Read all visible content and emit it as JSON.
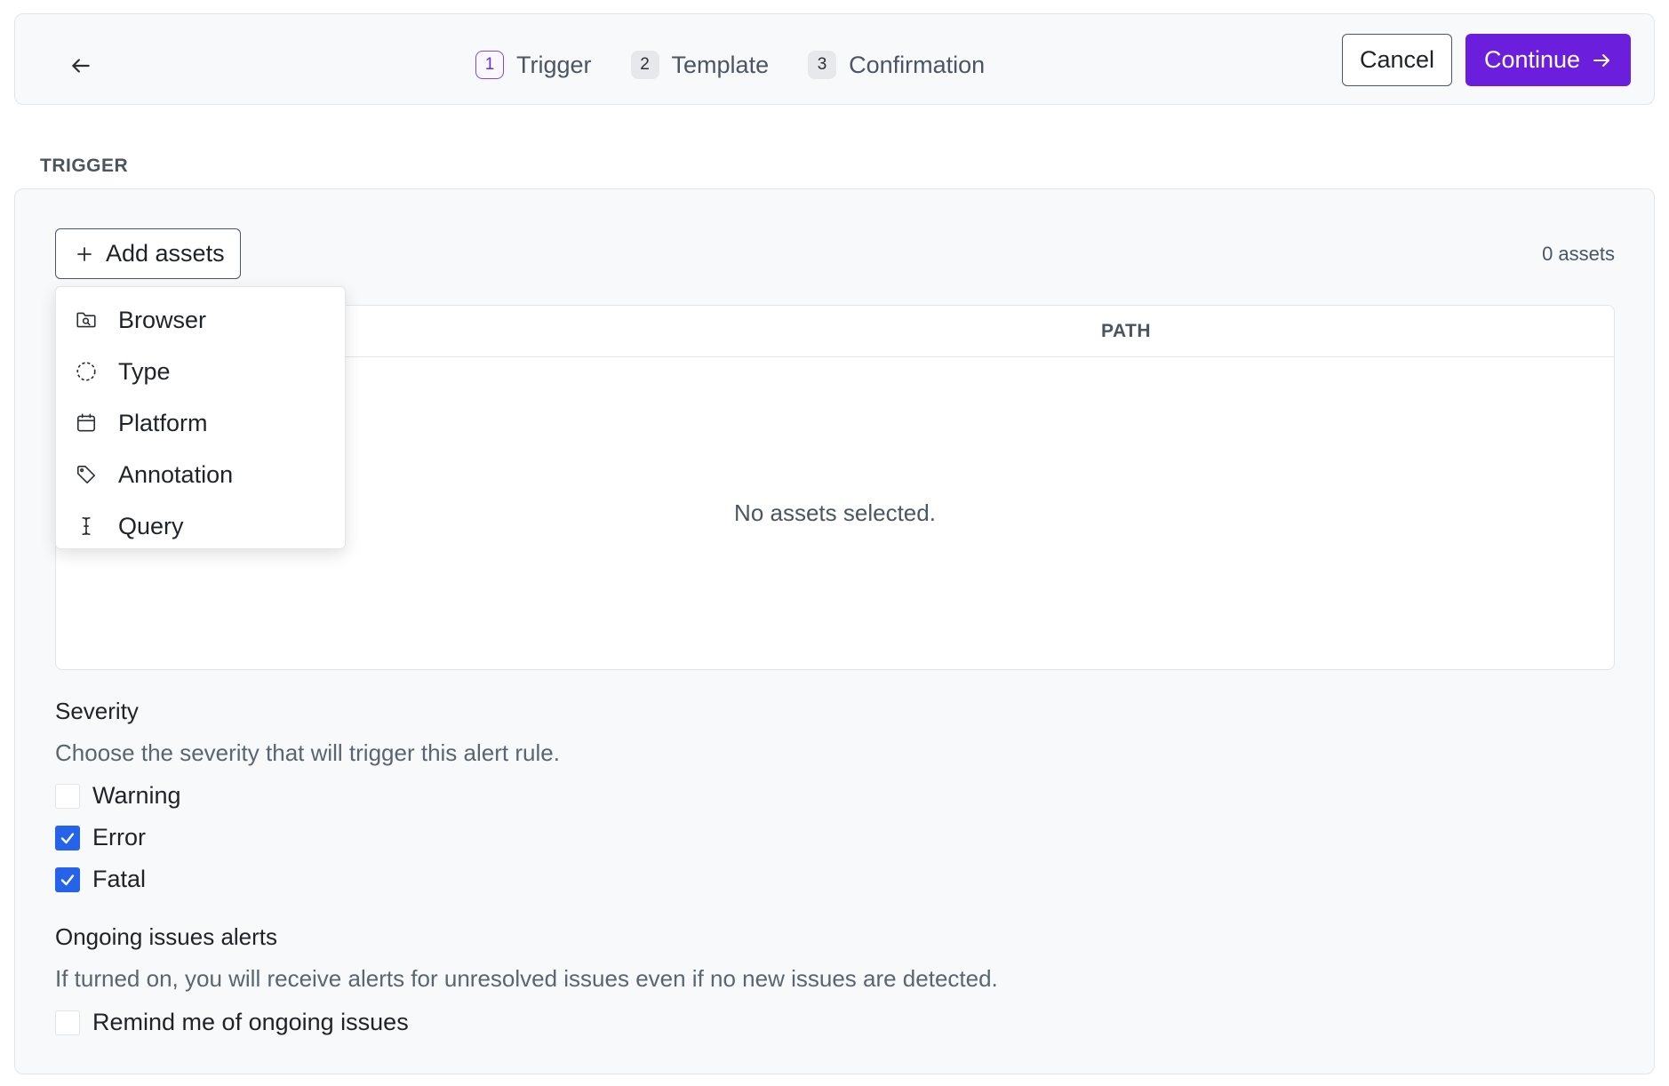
{
  "header": {
    "steps": [
      {
        "number": "1",
        "label": "Trigger",
        "active": true
      },
      {
        "number": "2",
        "label": "Template",
        "active": false
      },
      {
        "number": "3",
        "label": "Confirmation",
        "active": false
      }
    ],
    "cancel_label": "Cancel",
    "continue_label": "Continue"
  },
  "section_label": "TRIGGER",
  "assets": {
    "add_label": "Add assets",
    "count": "0 assets",
    "path_header": "PATH",
    "empty_message": "No assets selected."
  },
  "dropdown": {
    "items": [
      {
        "label": "Browser",
        "icon": "folder-search-icon"
      },
      {
        "label": "Type",
        "icon": "dashed-circle-icon"
      },
      {
        "label": "Platform",
        "icon": "calendar-icon"
      },
      {
        "label": "Annotation",
        "icon": "tag-icon"
      },
      {
        "label": "Query",
        "icon": "text-cursor-icon"
      }
    ]
  },
  "severity": {
    "title": "Severity",
    "description": "Choose the severity that will trigger this alert rule.",
    "options": [
      {
        "label": "Warning",
        "checked": false
      },
      {
        "label": "Error",
        "checked": true
      },
      {
        "label": "Fatal",
        "checked": true
      }
    ]
  },
  "ongoing": {
    "title": "Ongoing issues alerts",
    "description": "If turned on, you will receive alerts for unresolved issues even if no new issues are detected.",
    "option": {
      "label": "Remind me of ongoing issues",
      "checked": false
    }
  },
  "colors": {
    "accent": "#6b1fdc",
    "checkbox": "#2563eb"
  }
}
